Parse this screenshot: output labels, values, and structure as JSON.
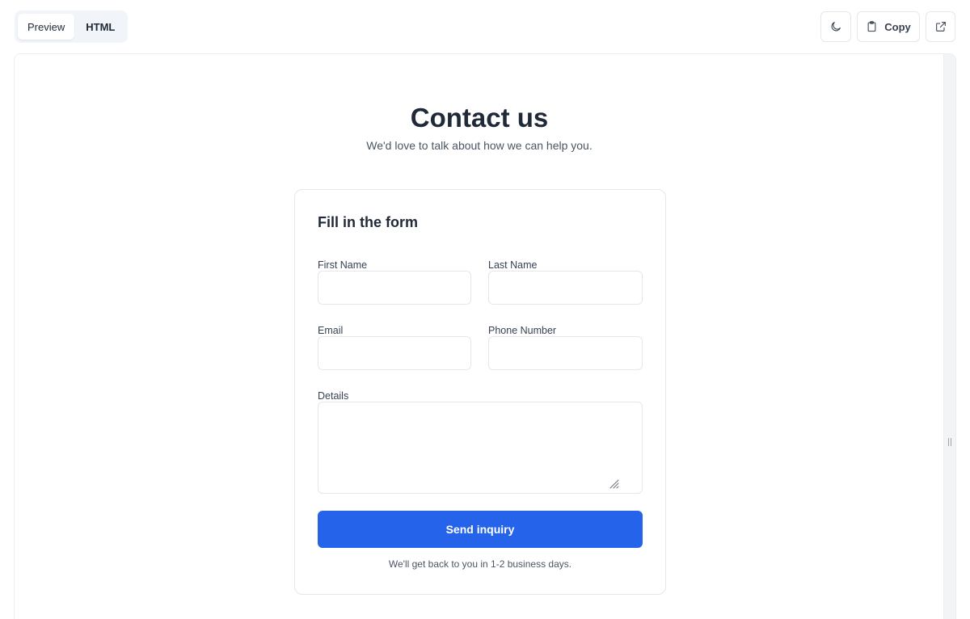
{
  "toolbar": {
    "tabs": [
      {
        "label": "Preview",
        "active": true
      },
      {
        "label": "HTML",
        "active": false
      }
    ],
    "copy_label": "Copy",
    "icons": {
      "theme": "moon-icon",
      "copy": "clipboard-icon",
      "open": "external-link-icon"
    }
  },
  "page": {
    "title": "Contact us",
    "subtitle": "We'd love to talk about how we can help you."
  },
  "form": {
    "title": "Fill in the form",
    "fields": {
      "first_name": {
        "label": "First Name",
        "value": ""
      },
      "last_name": {
        "label": "Last Name",
        "value": ""
      },
      "email": {
        "label": "Email",
        "value": ""
      },
      "phone": {
        "label": "Phone Number",
        "value": ""
      },
      "details": {
        "label": "Details",
        "value": ""
      }
    },
    "submit_label": "Send inquiry",
    "note": "We'll get back to you in 1-2 business days."
  },
  "colors": {
    "accent": "#2563eb",
    "heading": "#1f2937",
    "border": "#e5e7eb"
  }
}
